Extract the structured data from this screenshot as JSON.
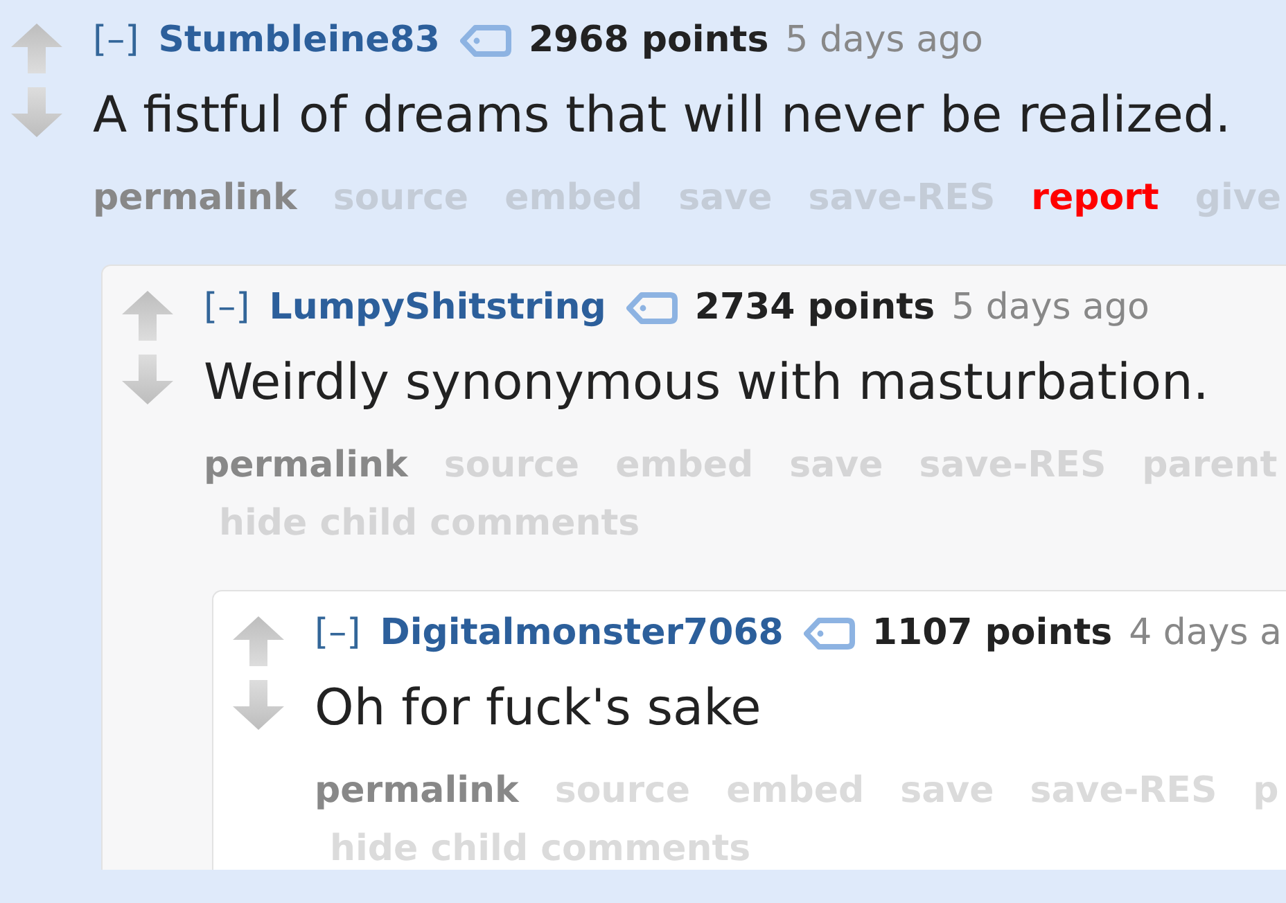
{
  "comments": [
    {
      "toggle": "[–]",
      "author": "Stumbleine83",
      "score": "2968 points",
      "time": "5 days ago",
      "body": "A fistful of dreams that will never be realized.",
      "actions": [
        {
          "label": "permalink",
          "kind": "active"
        },
        {
          "label": "source",
          "kind": "faded"
        },
        {
          "label": "embed",
          "kind": "faded"
        },
        {
          "label": "save",
          "kind": "faded"
        },
        {
          "label": "save-RES",
          "kind": "faded"
        },
        {
          "label": "report",
          "kind": "alert"
        },
        {
          "label": "give",
          "kind": "faded"
        }
      ],
      "children": [
        {
          "toggle": "[–]",
          "author": "LumpyShitstring",
          "score": "2734 points",
          "time": "5 days ago",
          "body": "Weirdly synonymous with masturbation.",
          "actions": [
            {
              "label": "permalink",
              "kind": "active"
            },
            {
              "label": "source",
              "kind": "faded"
            },
            {
              "label": "embed",
              "kind": "faded"
            },
            {
              "label": "save",
              "kind": "faded"
            },
            {
              "label": "save-RES",
              "kind": "faded"
            },
            {
              "label": "parent",
              "kind": "faded"
            },
            {
              "label": "hide child comments",
              "kind": "faded"
            }
          ],
          "children": [
            {
              "toggle": "[–]",
              "author": "Digitalmonster7068",
              "score": "1107 points",
              "time": "4 days a",
              "body": "Oh for fuck's sake",
              "actions": [
                {
                  "label": "permalink",
                  "kind": "active"
                },
                {
                  "label": "source",
                  "kind": "faded"
                },
                {
                  "label": "embed",
                  "kind": "faded"
                },
                {
                  "label": "save",
                  "kind": "faded"
                },
                {
                  "label": "save-RES",
                  "kind": "faded"
                },
                {
                  "label": "p",
                  "kind": "faded"
                },
                {
                  "label": "hide child comments",
                  "kind": "faded"
                }
              ]
            }
          ]
        }
      ]
    }
  ]
}
